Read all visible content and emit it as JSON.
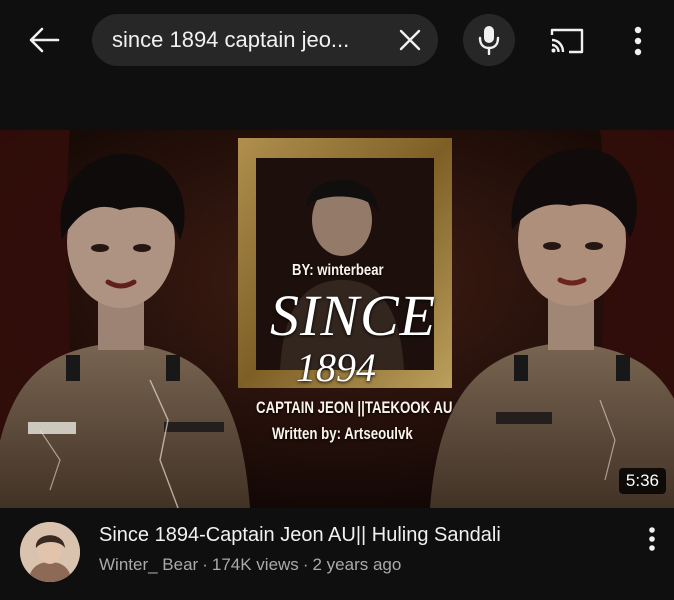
{
  "search": {
    "query": "since 1894 captain jeo..."
  },
  "video": {
    "title": "Since 1894-Captain Jeon AU|| Huling Sandali",
    "channel": "Winter_ Bear",
    "views": "174K views",
    "age": "2 years ago",
    "separator": "·",
    "duration": "5:36",
    "thumbnail_text": {
      "by": "BY: winterbear",
      "title_line1": "SINCE",
      "title_line2": "1894",
      "subtitle": "CAPTAIN JEON ||TAEKOOK AU",
      "written": "Written by: Artseoulvk"
    }
  },
  "icons": {
    "back": "arrow-left-icon",
    "clear": "close-icon",
    "mic": "microphone-icon",
    "cast": "cast-icon",
    "more": "more-vert-icon",
    "video_menu": "more-vert-icon"
  },
  "colors": {
    "background": "#0f0f0f",
    "pill": "#272727",
    "text_primary": "#f1f1f1",
    "text_secondary": "#aaaaaa"
  }
}
